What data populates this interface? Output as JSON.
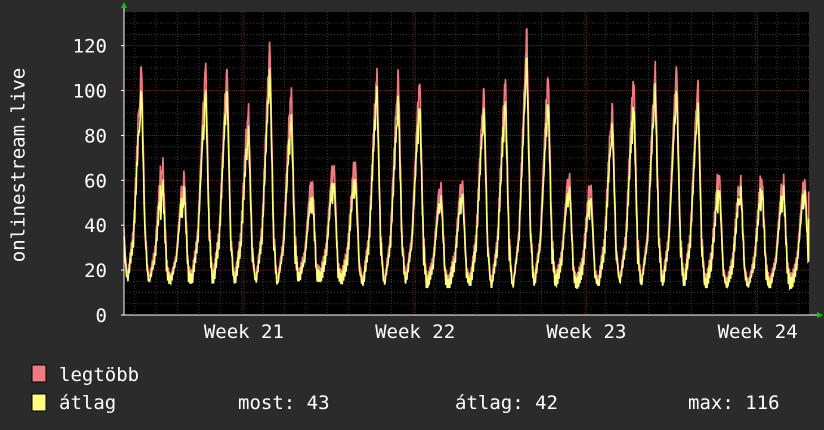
{
  "chart_data": {
    "type": "line",
    "ylabel": "onlinestream.live",
    "ylim": [
      0,
      135
    ],
    "yticks": [
      0,
      20,
      40,
      60,
      80,
      100,
      120
    ],
    "xlim_days": [
      0,
      32
    ],
    "xticks": [
      {
        "label": "Week 21",
        "day": 5.6
      },
      {
        "label": "Week 22",
        "day": 13.6
      },
      {
        "label": "Week 23",
        "day": 21.6
      },
      {
        "label": "Week 24",
        "day": 29.6
      }
    ],
    "grid": true,
    "series": [
      {
        "name": "legtöbb",
        "color": "#f07a80",
        "daily_peaks": [
          111,
          67,
          62,
          112,
          110,
          92,
          120,
          100,
          58,
          67,
          68,
          108,
          107,
          104,
          58,
          60,
          100,
          105,
          126,
          107,
          62,
          58,
          93,
          105,
          110,
          111,
          104,
          63,
          60
        ],
        "daily_mins": [
          18,
          17,
          16,
          17,
          17,
          17,
          17,
          16,
          18,
          18,
          17,
          16,
          16,
          17,
          15,
          15,
          16,
          15,
          14,
          16,
          16,
          15,
          16,
          17,
          16,
          16,
          16,
          15,
          15
        ],
        "final": 55
      },
      {
        "name": "átlag",
        "color": "#ffff80",
        "daily_peaks": [
          100,
          57,
          55,
          100,
          100,
          82,
          108,
          88,
          51,
          59,
          60,
          100,
          95,
          93,
          52,
          54,
          91,
          95,
          113,
          95,
          56,
          52,
          84,
          93,
          100,
          100,
          94,
          56,
          55
        ],
        "daily_mins": [
          16,
          15,
          15,
          15,
          15,
          15,
          15,
          14,
          16,
          16,
          15,
          14,
          14,
          15,
          13,
          13,
          14,
          13,
          13,
          14,
          14,
          13,
          14,
          15,
          14,
          14,
          14,
          13,
          13
        ],
        "final": 43
      }
    ]
  },
  "legend": {
    "items": [
      {
        "label": "legtöbb",
        "color": "#f07a80"
      },
      {
        "label": "átlag",
        "color": "#ffff80"
      }
    ],
    "stats": {
      "most": "most: 43",
      "atlag": "átlag: 42",
      "max": "max: 116"
    }
  },
  "colors": {
    "background": "#2b2b2b",
    "plot_background": "#000000",
    "grid_minor": "#3a3a3a",
    "grid_major": "#5a2a2a",
    "axis": "#ffffff",
    "arrow": "#00cc00"
  }
}
